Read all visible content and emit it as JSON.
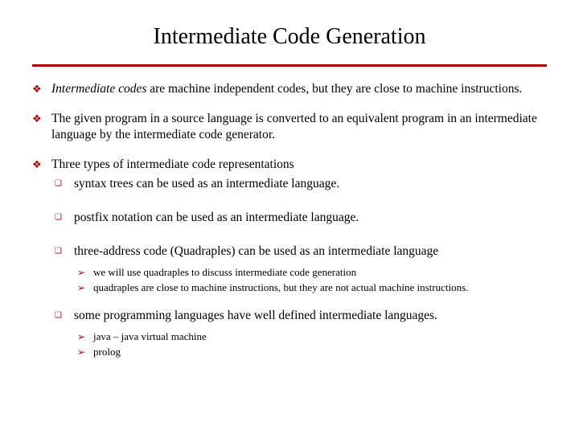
{
  "title": "Intermediate Code Generation",
  "b1_italic": "Intermediate codes ",
  "b1_rest": "are machine independent codes, but they are close  to machine instructions.",
  "b2": "The given program in a source language is converted to an equivalent program in an intermediate language by the intermediate code generator.",
  "b3": "Three types of intermediate code representations",
  "s1": "syntax trees can be used as an intermediate language.",
  "s2": "postfix notation can be used as an intermediate language.",
  "s3": "three-address code (Quadraples) can be used as an intermediate language",
  "a1": "we will use quadraples to discuss intermediate code generation",
  "a2": "quadraples are close to machine instructions, but they are not actual machine instructions.",
  "s4": "some programming languages have well defined intermediate languages.",
  "a3": "java – java virtual machine",
  "a4": "prolog"
}
